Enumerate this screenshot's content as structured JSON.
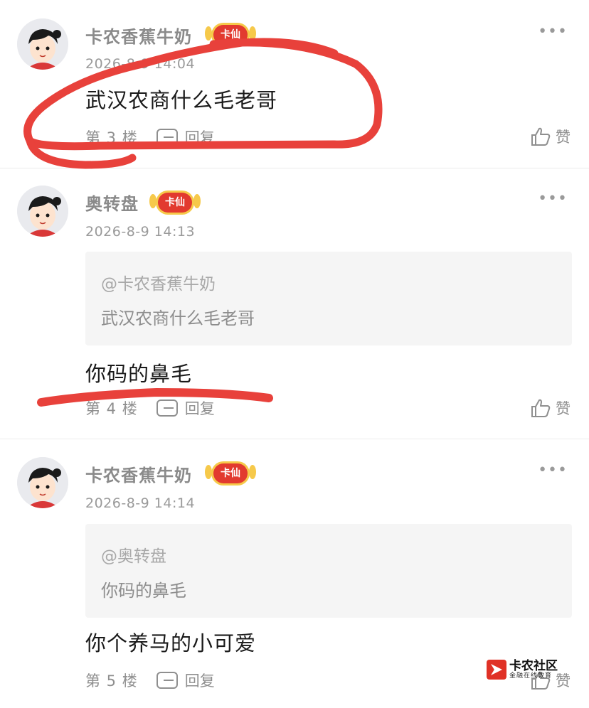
{
  "posts": [
    {
      "username": "卡农香蕉牛奶",
      "badge": "卡仙",
      "more": "•••",
      "time": "2026-8-9 14:04",
      "content": "武汉农商什么毛老哥",
      "floor": "第 3 楼",
      "reply_label": "回复",
      "like_label": "赞"
    },
    {
      "username": "奥转盘",
      "badge": "卡仙",
      "more": "•••",
      "time": "2026-8-9 14:13",
      "quote_user": "@卡农香蕉牛奶",
      "quote_text": "武汉农商什么毛老哥",
      "content": "你码的鼻毛",
      "floor": "第 4 楼",
      "reply_label": "回复",
      "like_label": "赞"
    },
    {
      "username": "卡农香蕉牛奶",
      "badge": "卡仙",
      "more": "•••",
      "time": "2026-8-9 14:14",
      "quote_user": "@奥转盘",
      "quote_text": "你码的鼻毛",
      "content": "你个养马的小可爱",
      "floor": "第 5 楼",
      "reply_label": "回复",
      "like_label": "赞"
    }
  ],
  "watermark": {
    "title": "卡农社区",
    "subtitle": "金融在线教育"
  },
  "colors": {
    "annotation_red": "#e8413b",
    "badge_red": "#e23a2f",
    "badge_gold": "#f6c94a"
  },
  "icons": [
    "avatar-icon",
    "more-icon",
    "reply-icon",
    "thumbs-up-icon",
    "kanong-logo-icon"
  ]
}
